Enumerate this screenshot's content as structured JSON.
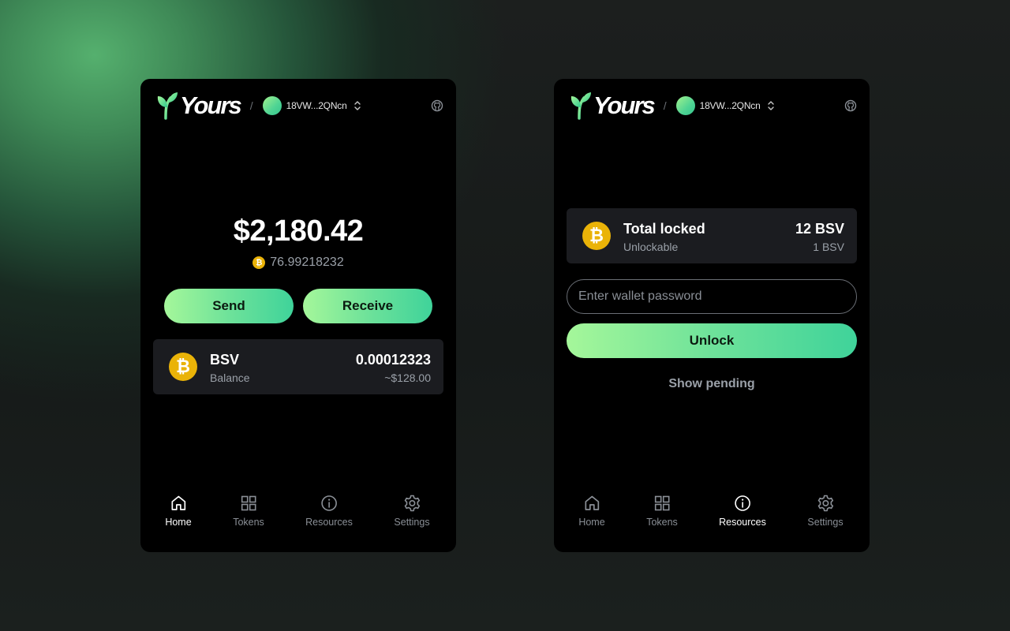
{
  "brand": {
    "name": "Yours"
  },
  "account": {
    "address": "18VW...2QNcn"
  },
  "home": {
    "balance_usd": "$2,180.42",
    "balance_bsv": "76.99218232",
    "send_label": "Send",
    "receive_label": "Receive",
    "asset": {
      "name": "BSV",
      "sub": "Balance",
      "amount": "0.00012323",
      "usd": "~$128.00"
    }
  },
  "resources": {
    "locked_title": "Total locked",
    "locked_amount": "12 BSV",
    "unlockable_label": "Unlockable",
    "unlockable_amount": "1 BSV",
    "password_placeholder": "Enter wallet password",
    "unlock_label": "Unlock",
    "show_pending_label": "Show pending"
  },
  "nav": {
    "items": [
      {
        "label": "Home",
        "icon": "home-icon"
      },
      {
        "label": "Tokens",
        "icon": "grid-icon"
      },
      {
        "label": "Resources",
        "icon": "info-icon"
      },
      {
        "label": "Settings",
        "icon": "gear-icon"
      }
    ]
  },
  "colors": {
    "accent_start": "#a5f79a",
    "accent_end": "#3fd39a",
    "coin": "#eab308",
    "card": "#1b1c20",
    "muted": "#9aa0a8"
  }
}
